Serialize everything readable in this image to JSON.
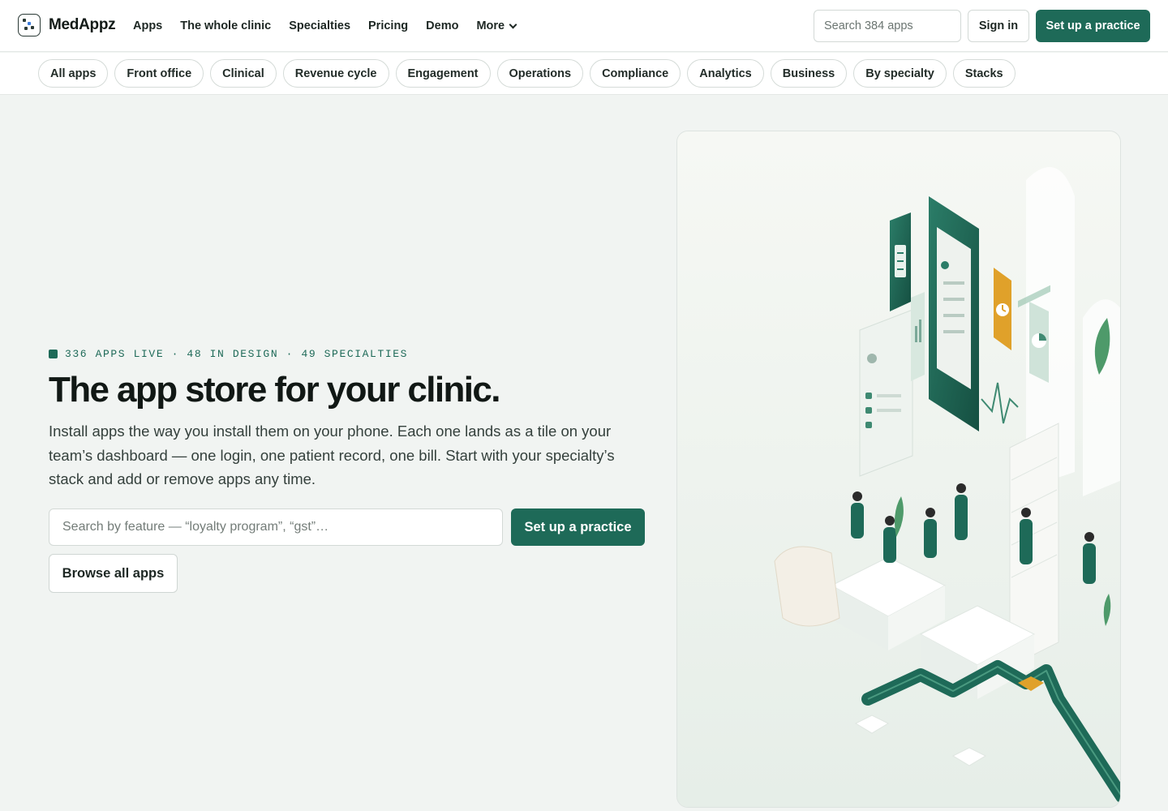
{
  "brand": {
    "name": "MedAppz"
  },
  "nav": {
    "links": [
      "Apps",
      "The whole clinic",
      "Specialties",
      "Pricing",
      "Demo"
    ],
    "more_label": "More",
    "search_placeholder": "Search 384 apps",
    "signin_label": "Sign in",
    "setup_label": "Set up a practice"
  },
  "categories": [
    "All apps",
    "Front office",
    "Clinical",
    "Revenue cycle",
    "Engagement",
    "Operations",
    "Compliance",
    "Analytics",
    "Business",
    "By specialty",
    "Stacks"
  ],
  "hero": {
    "eyebrow": "336 APPS LIVE · 48 IN DESIGN · 49 SPECIALTIES",
    "title": "The app store for your clinic.",
    "description": "Install apps the way you install them on your phone. Each one lands as a tile on your team’s dashboard — one login, one patient record, one bill. Start with your specialty’s stack and add or remove apps any time.",
    "search_placeholder": "Search by feature — “loyalty program”, “gst”…",
    "setup_label": "Set up a practice",
    "browse_label": "Browse all apps"
  },
  "colors": {
    "accent": "#1e6a58",
    "tile_orange": "#e0a12a",
    "background": "#f1f4f2"
  },
  "icons": [
    "calendar-icon",
    "chart-icon",
    "clock-icon",
    "pie-chart-icon",
    "chevron-down-icon"
  ]
}
